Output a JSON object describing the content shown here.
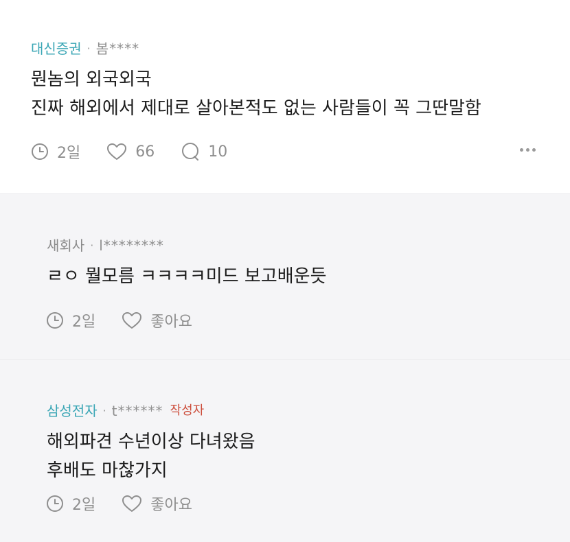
{
  "comments": [
    {
      "company": "대신증권",
      "user": "봄****",
      "lines": [
        "뭔놈의 외국외국",
        "진짜 해외에서 제대로 살아본적도 없는 사람들이 꼭 그딴말함"
      ],
      "time": "2일",
      "likes": "66",
      "replies": "10"
    },
    {
      "company": "새회사",
      "user": "l********",
      "lines": [
        "ㄹㅇ 뭘모름 ㅋㅋㅋㅋ미드 보고배운듯"
      ],
      "time": "2일",
      "like_label": "좋아요"
    },
    {
      "company": "삼성전자",
      "user": "t******",
      "author_tag": "작성자",
      "lines": [
        "해외파견 수년이상 다녀왔음",
        "후배도 마찮가지"
      ],
      "time": "2일",
      "like_label": "좋아요"
    }
  ],
  "colors": {
    "company_link": "#3aa6b5",
    "author_tag": "#cc4c3a",
    "reply_bg": "#f5f5f7"
  },
  "icons": [
    "clock-icon",
    "heart-icon",
    "speech-bubble-icon",
    "more-dots-icon"
  ]
}
